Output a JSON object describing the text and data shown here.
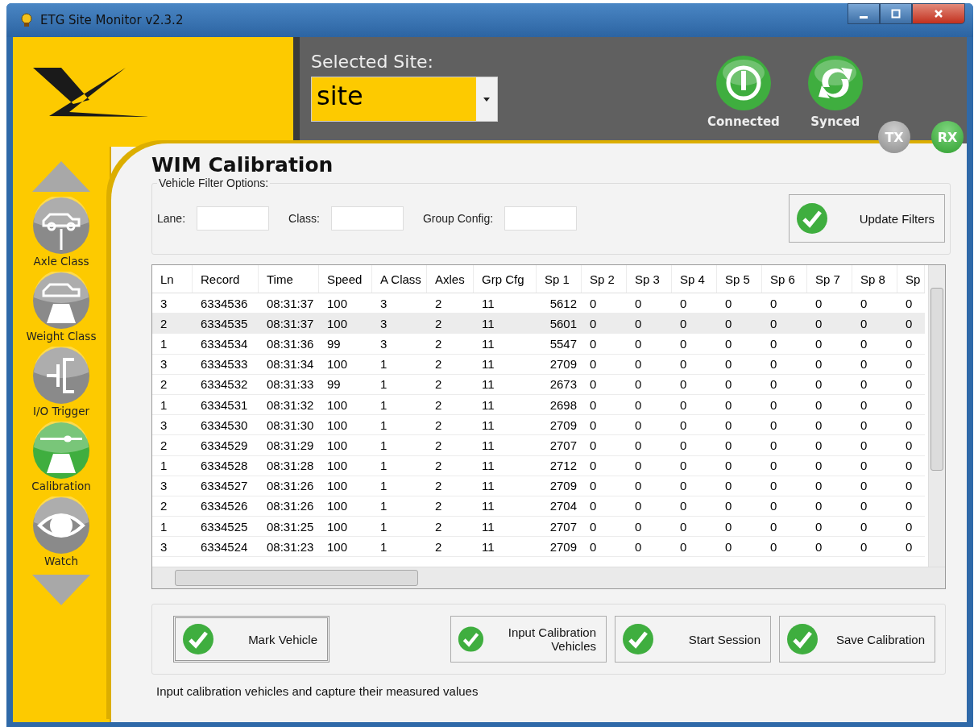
{
  "window": {
    "title": "ETG Site Monitor v2.3.2"
  },
  "site": {
    "label": "Selected Site:",
    "value": "site"
  },
  "status": [
    {
      "label": "Connected",
      "kind": "power",
      "on": true
    },
    {
      "label": "Synced",
      "kind": "sync",
      "on": true
    }
  ],
  "lights": [
    {
      "label": "TX",
      "on": false
    },
    {
      "label": "RX",
      "on": true
    }
  ],
  "nav": [
    {
      "label": "Axle Class",
      "kind": "axle",
      "selected": false
    },
    {
      "label": "Weight Class",
      "kind": "weight",
      "selected": false
    },
    {
      "label": "I/O Trigger",
      "kind": "trigger",
      "selected": false
    },
    {
      "label": "Calibration",
      "kind": "calibration",
      "selected": true
    },
    {
      "label": "Watch",
      "kind": "watch",
      "selected": false
    }
  ],
  "page_title": "WIM Calibration",
  "filters": {
    "legend": "Vehicle Filter Options:",
    "fields": [
      {
        "label": "Lane:"
      },
      {
        "label": "Class:"
      },
      {
        "label": "Group Config:"
      }
    ],
    "button": "Update Filters"
  },
  "table": {
    "columns": [
      "Ln",
      "Record",
      "Time",
      "Speed",
      "A Class",
      "Axles",
      "Grp Cfg",
      "Sp 1",
      "Sp 2",
      "Sp 3",
      "Sp 4",
      "Sp 5",
      "Sp 6",
      "Sp 7",
      "Sp 8",
      "Sp"
    ],
    "rows": [
      {
        "selected": false,
        "cells": [
          "3",
          "6334536",
          "08:31:37",
          "100",
          "3",
          "2",
          "11",
          "5612",
          "0",
          "0",
          "0",
          "0",
          "0",
          "0",
          "0",
          "0"
        ]
      },
      {
        "selected": true,
        "cells": [
          "2",
          "6334535",
          "08:31:37",
          "100",
          "3",
          "2",
          "11",
          "5601",
          "0",
          "0",
          "0",
          "0",
          "0",
          "0",
          "0",
          "0"
        ]
      },
      {
        "selected": false,
        "cells": [
          "1",
          "6334534",
          "08:31:36",
          "99",
          "3",
          "2",
          "11",
          "5547",
          "0",
          "0",
          "0",
          "0",
          "0",
          "0",
          "0",
          "0"
        ]
      },
      {
        "selected": false,
        "cells": [
          "3",
          "6334533",
          "08:31:34",
          "100",
          "1",
          "2",
          "11",
          "2709",
          "0",
          "0",
          "0",
          "0",
          "0",
          "0",
          "0",
          "0"
        ]
      },
      {
        "selected": false,
        "cells": [
          "2",
          "6334532",
          "08:31:33",
          "99",
          "1",
          "2",
          "11",
          "2673",
          "0",
          "0",
          "0",
          "0",
          "0",
          "0",
          "0",
          "0"
        ]
      },
      {
        "selected": false,
        "cells": [
          "1",
          "6334531",
          "08:31:32",
          "100",
          "1",
          "2",
          "11",
          "2698",
          "0",
          "0",
          "0",
          "0",
          "0",
          "0",
          "0",
          "0"
        ]
      },
      {
        "selected": false,
        "cells": [
          "3",
          "6334530",
          "08:31:30",
          "100",
          "1",
          "2",
          "11",
          "2709",
          "0",
          "0",
          "0",
          "0",
          "0",
          "0",
          "0",
          "0"
        ]
      },
      {
        "selected": false,
        "cells": [
          "2",
          "6334529",
          "08:31:29",
          "100",
          "1",
          "2",
          "11",
          "2707",
          "0",
          "0",
          "0",
          "0",
          "0",
          "0",
          "0",
          "0"
        ]
      },
      {
        "selected": false,
        "cells": [
          "1",
          "6334528",
          "08:31:28",
          "100",
          "1",
          "2",
          "11",
          "2712",
          "0",
          "0",
          "0",
          "0",
          "0",
          "0",
          "0",
          "0"
        ]
      },
      {
        "selected": false,
        "cells": [
          "3",
          "6334527",
          "08:31:26",
          "100",
          "1",
          "2",
          "11",
          "2709",
          "0",
          "0",
          "0",
          "0",
          "0",
          "0",
          "0",
          "0"
        ]
      },
      {
        "selected": false,
        "cells": [
          "2",
          "6334526",
          "08:31:26",
          "100",
          "1",
          "2",
          "11",
          "2704",
          "0",
          "0",
          "0",
          "0",
          "0",
          "0",
          "0",
          "0"
        ]
      },
      {
        "selected": false,
        "cells": [
          "1",
          "6334525",
          "08:31:25",
          "100",
          "1",
          "2",
          "11",
          "2707",
          "0",
          "0",
          "0",
          "0",
          "0",
          "0",
          "0",
          "0"
        ]
      },
      {
        "selected": false,
        "cells": [
          "3",
          "6334524",
          "08:31:23",
          "100",
          "1",
          "2",
          "11",
          "2709",
          "0",
          "0",
          "0",
          "0",
          "0",
          "0",
          "0",
          "0"
        ]
      }
    ]
  },
  "actions": [
    {
      "label": "Mark Vehicle",
      "focused": true
    },
    {
      "label": "Input Calibration Vehicles",
      "focused": false
    },
    {
      "label": "Start Session",
      "focused": false
    },
    {
      "label": "Save Calibration",
      "focused": false
    }
  ],
  "status_text": "Input calibration vehicles and capture their measured values"
}
